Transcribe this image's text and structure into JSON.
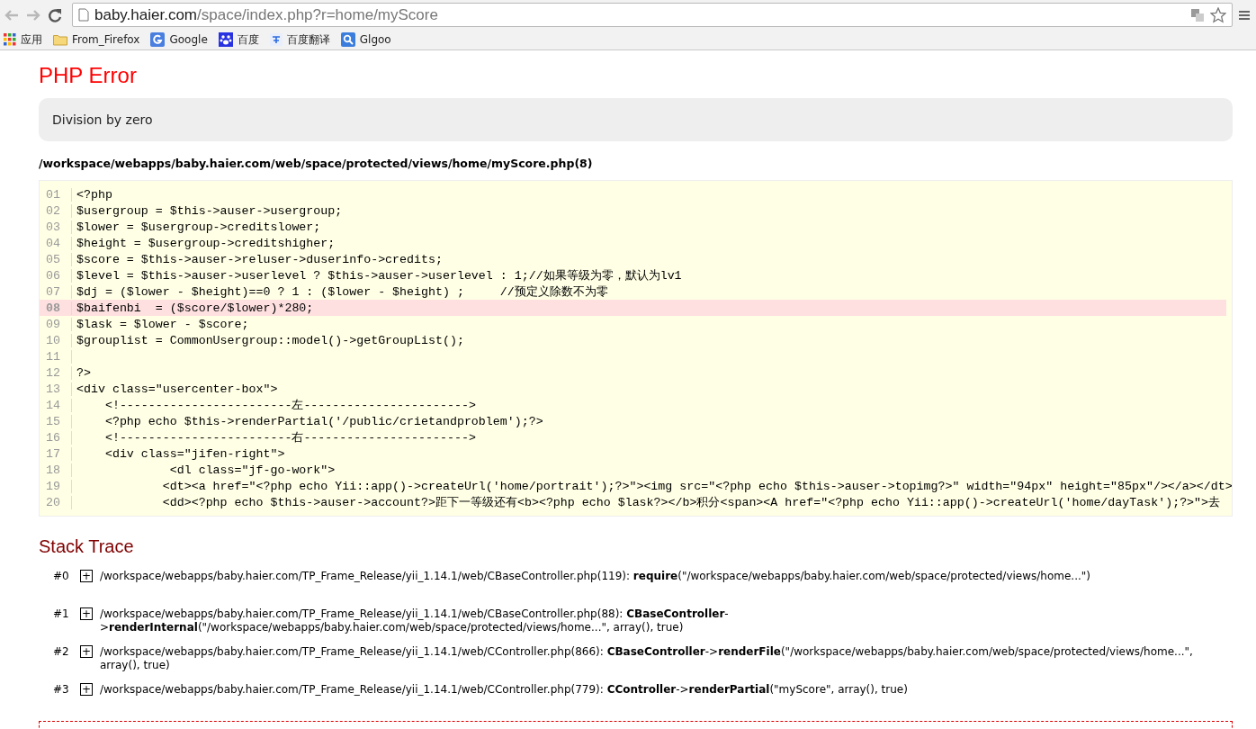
{
  "browser": {
    "url_host": "baby.haier.com",
    "url_path": "/space/index.php?r=home/myScore",
    "bookmarks": [
      {
        "label": "应用",
        "kind": "apps"
      },
      {
        "label": "From_Firefox",
        "kind": "folder"
      },
      {
        "label": "Google",
        "kind": "google"
      },
      {
        "label": "百度",
        "kind": "paw"
      },
      {
        "label": "百度翻译",
        "kind": "translate"
      },
      {
        "label": "Glgoo",
        "kind": "search"
      }
    ]
  },
  "error": {
    "title": "PHP Error",
    "message": "Division by zero",
    "file": "/workspace/webapps/baby.haier.com/web/space/protected/views/home/myScore.php(8)"
  },
  "source": [
    {
      "no": "01",
      "code": "<?php",
      "selected": false
    },
    {
      "no": "02",
      "code": "$usergroup = $this->auser->usergroup;",
      "selected": false
    },
    {
      "no": "03",
      "code": "$lower = $usergroup->creditslower;",
      "selected": false
    },
    {
      "no": "04",
      "code": "$height = $usergroup->creditshigher;",
      "selected": false
    },
    {
      "no": "05",
      "code": "$score = $this->auser->reluser->duserinfo->credits;",
      "selected": false
    },
    {
      "no": "06",
      "code": "$level = $this->auser->userlevel ? $this->auser->userlevel : 1;//如果等级为零，默认为lv1",
      "selected": false
    },
    {
      "no": "07",
      "code": "$dj = ($lower - $height)==0 ? 1 : ($lower - $height) ;     //预定义除数不为零",
      "selected": false
    },
    {
      "no": "08",
      "code": "$baifenbi  = ($score/$lower)*280;",
      "selected": true
    },
    {
      "no": "09",
      "code": "$lask = $lower - $score;",
      "selected": false
    },
    {
      "no": "10",
      "code": "$grouplist = CommonUsergroup::model()->getGroupList();",
      "selected": false
    },
    {
      "no": "11",
      "selected": false
    },
    {
      "no": "12",
      "code": "?>",
      "selected": false
    },
    {
      "no": "13",
      "code": "<div class=\"usercenter-box\">",
      "selected": false
    },
    {
      "no": "14",
      "code": "    <!------------------------左----------------------->",
      "selected": false
    },
    {
      "no": "15",
      "code": "    <?php echo $this->renderPartial('/public/crietandproblem');?>",
      "selected": false
    },
    {
      "no": "16",
      "code": "    <!------------------------右----------------------->",
      "selected": false
    },
    {
      "no": "17",
      "code": "    <div class=\"jifen-right\">",
      "selected": false
    },
    {
      "no": "18",
      "code": "             <dl class=\"jf-go-work\">",
      "selected": false
    },
    {
      "no": "19",
      "code": "            <dt><a href=\"<?php echo Yii::app()->createUrl('home/portrait');?>\"><img src=\"<?php echo $this->auser->topimg?>\" width=\"94px\" height=\"85px\"/></a></dt>",
      "selected": false
    },
    {
      "no": "20",
      "code": "            <dd><?php echo $this->auser->account?>距下一等级还有<b><?php echo $lask?></b>积分<span><A href=\"<?php echo Yii::app()->createUrl('home/dayTask');?>\">去",
      "selected": false
    }
  ],
  "stack_title": "Stack Trace",
  "trace": [
    {
      "no": "#0",
      "expand": "+",
      "text": "/workspace/webapps/baby.haier.com/TP_Frame_Release/yii_1.14.1/web/CBaseController.php(119): **require**(\"/workspace/webapps/baby.haier.com/web/space/protected/views/home...\")"
    },
    {
      "no": "#1",
      "expand": "+",
      "text": "/workspace/webapps/baby.haier.com/TP_Frame_Release/yii_1.14.1/web/CBaseController.php(88): **CBaseController**->**renderInternal**(\"/workspace/webapps/baby.haier.com/web/space/protected/views/home...\", array(), true)"
    },
    {
      "no": "#2",
      "expand": "+",
      "text": "/workspace/webapps/baby.haier.com/TP_Frame_Release/yii_1.14.1/web/CController.php(866): **CBaseController**->**renderFile**(\"/workspace/webapps/baby.haier.com/web/space/protected/views/home...\", array(), true)"
    },
    {
      "no": "#3",
      "expand": "+",
      "text": "/workspace/webapps/baby.haier.com/TP_Frame_Release/yii_1.14.1/web/CController.php(779): **CController**->**renderPartial**(\"myScore\", array(), true)"
    }
  ]
}
